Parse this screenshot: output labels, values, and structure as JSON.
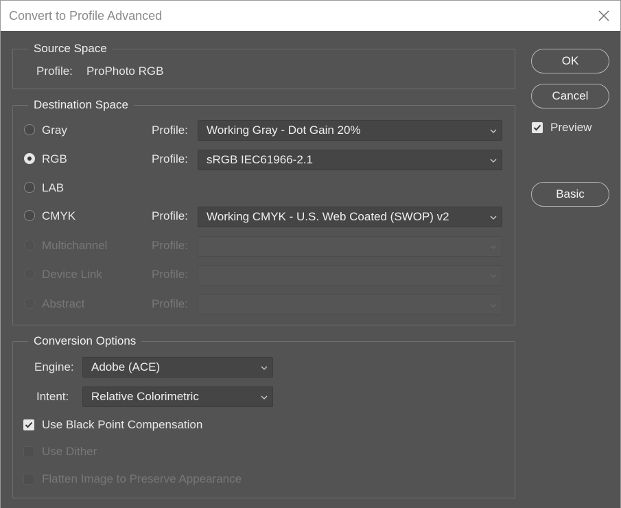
{
  "window": {
    "title": "Convert to Profile Advanced"
  },
  "source_space": {
    "legend": "Source Space",
    "profile_label": "Profile:",
    "profile_value": "ProPhoto RGB"
  },
  "destination_space": {
    "legend": "Destination Space",
    "rows": [
      {
        "label": "Gray",
        "profile_label": "Profile:",
        "profile": "Working Gray - Dot Gain 20%",
        "selected": false,
        "enabled": true
      },
      {
        "label": "RGB",
        "profile_label": "Profile:",
        "profile": "sRGB IEC61966-2.1",
        "selected": true,
        "enabled": true
      },
      {
        "label": "LAB",
        "selected": false,
        "enabled": true
      },
      {
        "label": "CMYK",
        "profile_label": "Profile:",
        "profile": "Working CMYK - U.S. Web Coated (SWOP) v2",
        "selected": false,
        "enabled": true
      },
      {
        "label": "Multichannel",
        "profile_label": "Profile:",
        "profile": "",
        "selected": false,
        "enabled": false
      },
      {
        "label": "Device Link",
        "profile_label": "Profile:",
        "profile": "",
        "selected": false,
        "enabled": false
      },
      {
        "label": "Abstract",
        "profile_label": "Profile:",
        "profile": "",
        "selected": false,
        "enabled": false
      }
    ]
  },
  "conversion_options": {
    "legend": "Conversion Options",
    "engine_label": "Engine:",
    "engine_value": "Adobe (ACE)",
    "intent_label": "Intent:",
    "intent_value": "Relative Colorimetric",
    "black_point": {
      "label": "Use Black Point Compensation",
      "checked": true,
      "enabled": true
    },
    "dither": {
      "label": "Use Dither",
      "checked": false,
      "enabled": false
    },
    "flatten": {
      "label": "Flatten Image to Preserve Appearance",
      "checked": false,
      "enabled": false
    }
  },
  "buttons": {
    "ok": "OK",
    "cancel": "Cancel",
    "basic": "Basic"
  },
  "preview": {
    "label": "Preview",
    "checked": true
  },
  "colors": {
    "background": "#535353",
    "titlebar": "#ffffff",
    "text": "#e8e8e8",
    "disabled_text": "#777777"
  }
}
